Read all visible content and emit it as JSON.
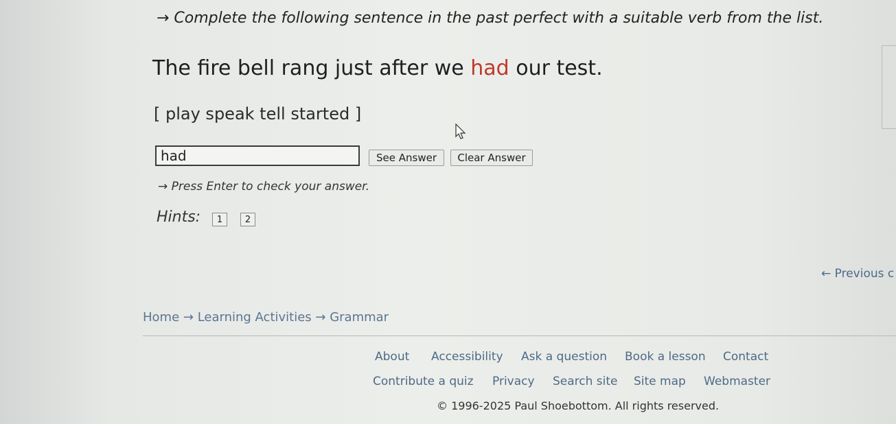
{
  "exercise": {
    "instruction": "→ Complete the following sentence in the past perfect with a suitable verb from the list.",
    "sentence_before": "The fire bell rang just after we ",
    "sentence_answer": "had",
    "sentence_after": " our test.",
    "word_list": "[ play speak tell started ]",
    "input_value": "had",
    "see_answer_label": "See Answer",
    "clear_answer_label": "Clear Answer",
    "enter_note": "→ Press Enter to check your answer.",
    "hints_label": "Hints:",
    "hint_buttons": [
      "1",
      "2"
    ]
  },
  "nav": {
    "previous_label": "← Previous c"
  },
  "breadcrumb": {
    "home": "Home",
    "sep1": " → ",
    "learning": "Learning Activities",
    "sep2": " → ",
    "grammar": "Grammar"
  },
  "footer": {
    "row1": [
      "About",
      "Accessibility",
      "Ask a question",
      "Book a lesson",
      "Contact"
    ],
    "row2": [
      "Contribute a quiz",
      "Privacy",
      "Search site",
      "Site map",
      "Webmaster"
    ],
    "copyright": "© 1996-2025 Paul Shoebottom. All rights reserved."
  }
}
